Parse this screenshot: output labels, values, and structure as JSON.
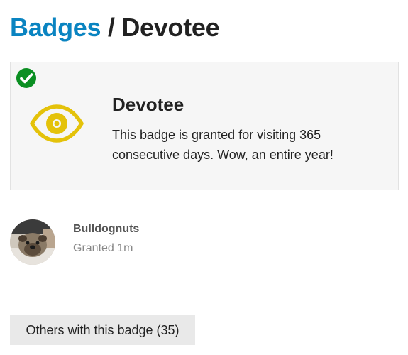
{
  "breadcrumb": {
    "parent": "Badges",
    "separator": " / ",
    "current": "Devotee"
  },
  "badge": {
    "name": "Devotee",
    "description": "This badge is granted for visiting 365 consecutive days. Wow, an entire year!",
    "icon": "eye-icon",
    "icon_color": "#e4c20a",
    "granted_icon": "check-circle-icon",
    "granted_color": "#0b8f22"
  },
  "grantee": {
    "username": "Bulldognuts",
    "granted_text": "Granted 1m",
    "avatar": "bulldog-avatar"
  },
  "others_button": {
    "label": "Others with this badge (35)"
  },
  "colors": {
    "link": "#0a84c1",
    "card_bg": "#f6f6f6",
    "button_bg": "#e9e9e9"
  }
}
